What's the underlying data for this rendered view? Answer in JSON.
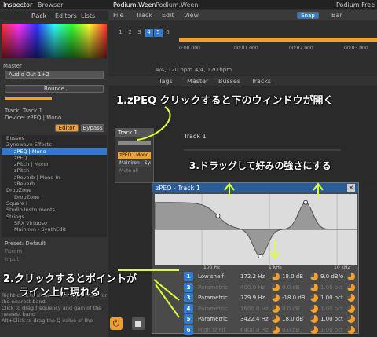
{
  "app": {
    "title": "Podium Free"
  },
  "inspector": {
    "tabs": [
      "Inspector",
      "Browser"
    ],
    "sub_tabs": [
      "Rack",
      "Editors",
      "Lists"
    ],
    "master_label": "Master",
    "audio_out": "Audio Out 1+2",
    "bounce": "Bounce",
    "track_label": "Track",
    "track_value": "Track 1",
    "device_label": "Device",
    "device_value": "zPEQ | Mono",
    "editor_btn": "Editor",
    "bypass_btn": "Bypass",
    "preset_label": "Preset",
    "preset_value": "Default",
    "param_label": "Param",
    "input_label": "Input"
  },
  "tree": {
    "items": [
      "Busses",
      "Zynewave Effects",
      "zPEQ | Mono",
      "zPEQ",
      "zPitch | Mono",
      "zPitch",
      "zReverb | Mono In",
      "zReverb",
      "DropZone",
      "DropZone",
      "Square I",
      "Studio Instruments",
      "Strings",
      "SRX Virtuoso",
      "Mainiron - SynthEdit"
    ]
  },
  "help": {
    "lines": [
      "Right-click to show a band type menu for",
      "the nearest band",
      "Click to drag frequency and gain of the",
      "nearest band",
      "Alt+Click to drag the Q value of the"
    ]
  },
  "project": {
    "tabs": [
      "Podium.Ween",
      "Podium.Ween"
    ],
    "menus": [
      "File",
      "Track",
      "Edit",
      "View"
    ],
    "snap": "Snap",
    "bar": "Bar",
    "bars": [
      "1",
      "2",
      "3",
      "4",
      "5",
      "6"
    ],
    "timecodes": [
      "0:00.000",
      "00:01.000",
      "00:02.000",
      "00:03.000"
    ],
    "time_sig": "4/4, 120 bpm",
    "time_sig2": "4/4, 120 bpm"
  },
  "mixer": {
    "tabs": [
      "Tags",
      "Master",
      "Busses",
      "Tracks"
    ],
    "track_name": "Track 1",
    "track_header": "Track 1",
    "device_chain": [
      "zPEQ | Mono",
      "Mainiron - SynthEdit",
      "Mute all"
    ]
  },
  "eq": {
    "title": "zPEQ - Track 1",
    "freq_labels": [
      "100 Hz",
      "1 kHz",
      "10 kHz"
    ],
    "bands": [
      {
        "n": "1",
        "type": "Low shelf",
        "freq": "172.2 Hz",
        "gain": "18.0 dB",
        "slope": "9.0 dB/o",
        "active": true
      },
      {
        "n": "2",
        "type": "Parametric",
        "freq": "400.0 Hz",
        "gain": "0.0 dB",
        "slope": "1.00 oct",
        "active": false
      },
      {
        "n": "3",
        "type": "Parametric",
        "freq": "729.9 Hz",
        "gain": "-18.0 dB",
        "slope": "1.00 oct",
        "active": true
      },
      {
        "n": "4",
        "type": "Parametric",
        "freq": "1600.0 Hz",
        "gain": "0.0 dB",
        "slope": "1.00 oct",
        "active": false
      },
      {
        "n": "5",
        "type": "Parametric",
        "freq": "3422.4 Hz",
        "gain": "18.0 dB",
        "slope": "1.00 oct",
        "active": true
      },
      {
        "n": "6",
        "type": "High shelf",
        "freq": "6400.0 Hz",
        "gain": "0.0 dB",
        "slope": "1.00 oct",
        "active": false
      }
    ]
  },
  "annotations": {
    "a1": "1.zPEQ クリックすると下のウィンドウが開く",
    "a2": "2.クリックするとポイントが",
    "a2b": "ライン上に現れる",
    "a3": "3.ドラッグして好みの強さにする"
  },
  "colors": {
    "accent": "#f0a030",
    "blue": "#2e7bd1",
    "band_active": "#ffffff",
    "curve_fill": "#999999"
  }
}
